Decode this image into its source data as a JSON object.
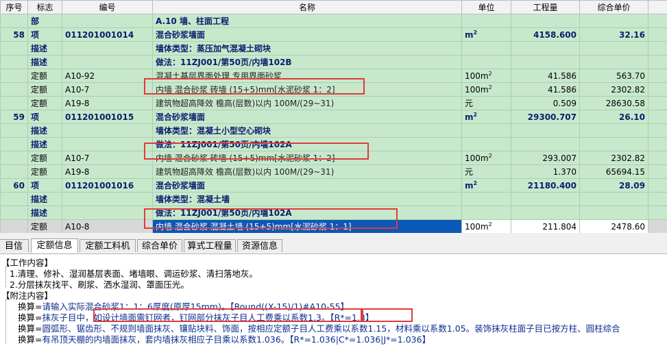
{
  "columns": {
    "seq": "序号",
    "type": "标志",
    "code": "编号",
    "name": "名称",
    "unit": "单位",
    "qty": "工程量",
    "price": "综合单价"
  },
  "rows": [
    {
      "seq": "",
      "type": "部",
      "code": "",
      "name": "A.10 墙、柱面工程",
      "unit": "",
      "unit_sup": "",
      "qty": "",
      "price": "",
      "style": "section"
    },
    {
      "seq": "58",
      "type": "项",
      "code": "011201001014",
      "name": "混合砂浆墙面",
      "unit": "m",
      "unit_sup": "2",
      "qty": "4158.600",
      "price": "32.16",
      "style": "bold"
    },
    {
      "seq": "",
      "type": "描述",
      "code": "",
      "name": "墙体类型：蒸压加气混凝土砌块",
      "unit": "",
      "unit_sup": "",
      "qty": "",
      "price": "",
      "style": "desc"
    },
    {
      "seq": "",
      "type": "描述",
      "code": "",
      "name": "做法：11ZJ001/第50页/内墙102B",
      "unit": "",
      "unit_sup": "",
      "qty": "",
      "price": "",
      "style": "desc"
    },
    {
      "seq": "",
      "type": "定额",
      "code": "A10-92",
      "name": "混凝土基层界面处理 专用界面砂浆",
      "unit": "100m",
      "unit_sup": "2",
      "qty": "41.586",
      "price": "563.70",
      "style": "norm"
    },
    {
      "seq": "",
      "type": "定额",
      "code": "A10-7",
      "name": "内墙 混合砂浆 砖墙 (15+5)mm[水泥砂浆 1：2]",
      "unit": "100m",
      "unit_sup": "2",
      "qty": "41.586",
      "price": "2302.82",
      "style": "norm"
    },
    {
      "seq": "",
      "type": "定额",
      "code": "A19-8",
      "name": "建筑物超高降效 檐高(层数)以内 100M/(29~31)",
      "unit": "元",
      "unit_sup": "",
      "qty": "0.509",
      "price": "28630.58",
      "style": "norm"
    },
    {
      "seq": "59",
      "type": "项",
      "code": "011201001015",
      "name": "混合砂浆墙面",
      "unit": "m",
      "unit_sup": "2",
      "qty": "29300.707",
      "price": "26.10",
      "style": "bold"
    },
    {
      "seq": "",
      "type": "描述",
      "code": "",
      "name": "墙体类型：混凝土小型空心砌块",
      "unit": "",
      "unit_sup": "",
      "qty": "",
      "price": "",
      "style": "desc"
    },
    {
      "seq": "",
      "type": "描述",
      "code": "",
      "name": "做法：11ZJ001/第50页/内墙102A",
      "unit": "",
      "unit_sup": "",
      "qty": "",
      "price": "",
      "style": "desc"
    },
    {
      "seq": "",
      "type": "定额",
      "code": "A10-7",
      "name": "内墙 混合砂浆 砖墙 (15+5)mm[水泥砂浆 1：2]",
      "unit": "100m",
      "unit_sup": "2",
      "qty": "293.007",
      "price": "2302.82",
      "style": "norm"
    },
    {
      "seq": "",
      "type": "定额",
      "code": "A19-8",
      "name": "建筑物超高降效 檐高(层数)以内 100M/(29~31)",
      "unit": "元",
      "unit_sup": "",
      "qty": "1.370",
      "price": "65694.15",
      "style": "norm"
    },
    {
      "seq": "60",
      "type": "项",
      "code": "011201001016",
      "name": "混合砂浆墙面",
      "unit": "m",
      "unit_sup": "2",
      "qty": "21180.400",
      "price": "28.09",
      "style": "bold"
    },
    {
      "seq": "",
      "type": "描述",
      "code": "",
      "name": "墙体类型：混凝土墙",
      "unit": "",
      "unit_sup": "",
      "qty": "",
      "price": "",
      "style": "desc"
    },
    {
      "seq": "",
      "type": "描述",
      "code": "",
      "name": "做法：11ZJ001/第50页/内墙102A",
      "unit": "",
      "unit_sup": "",
      "qty": "",
      "price": "",
      "style": "desc"
    },
    {
      "seq": "",
      "type": "定额",
      "code": "A10-8",
      "name": "内墙 混合砂浆 混凝土墙 (15+5)mm[水泥砂浆 1：1]",
      "unit": "100m",
      "unit_sup": "2",
      "qty": "211.804",
      "price": "2478.60",
      "style": "norm selected"
    }
  ],
  "tabs": [
    "目信息",
    "定额信息",
    "定额工料机",
    "综合单价",
    "算式工程量",
    "资源信息"
  ],
  "active_tab": "定额信息",
  "info": {
    "work_header": "【工作内容】",
    "work_items": [
      "1.清理、修补、湿润基层表面、堵墙眼、调运砂浆、清扫落地灰。",
      "2.分层抹灰找平、刷浆、洒水湿润、罩面压光。"
    ],
    "notes_header": "【附注内容】",
    "notes": [
      {
        "prefix": "换算=",
        "text": "请输入实际混合砂浆1：1：6厚度(原厚15mm)。【Round((X-15)/1)#A10-55】"
      },
      {
        "prefix": "换算=",
        "text": "抹灰子目中，如设计墙面需钉网者，钉网部分抹灰子目人工费乘以系数1.3。【R*=1.3】"
      },
      {
        "prefix": "换算=",
        "text": "圆弧形、锯齿形、不规则墙面抹灰、镶贴块料、饰面，按相应定额子目人工费乘以系数1.15，材料乘以系数1.05。装饰抹灰柱面子目已按方柱、圆柱综合"
      },
      {
        "prefix": "换算=",
        "text": "有吊顶天棚的内墙面抹灰，套内墙抹灰相应子目乘以系数1.036。【R*=1.036|C*=1.036|J*=1.036】"
      }
    ]
  },
  "highlight_color": "#e03a3a",
  "selection_color": "#0b58b8",
  "grid_bg": "#c8e8cc"
}
